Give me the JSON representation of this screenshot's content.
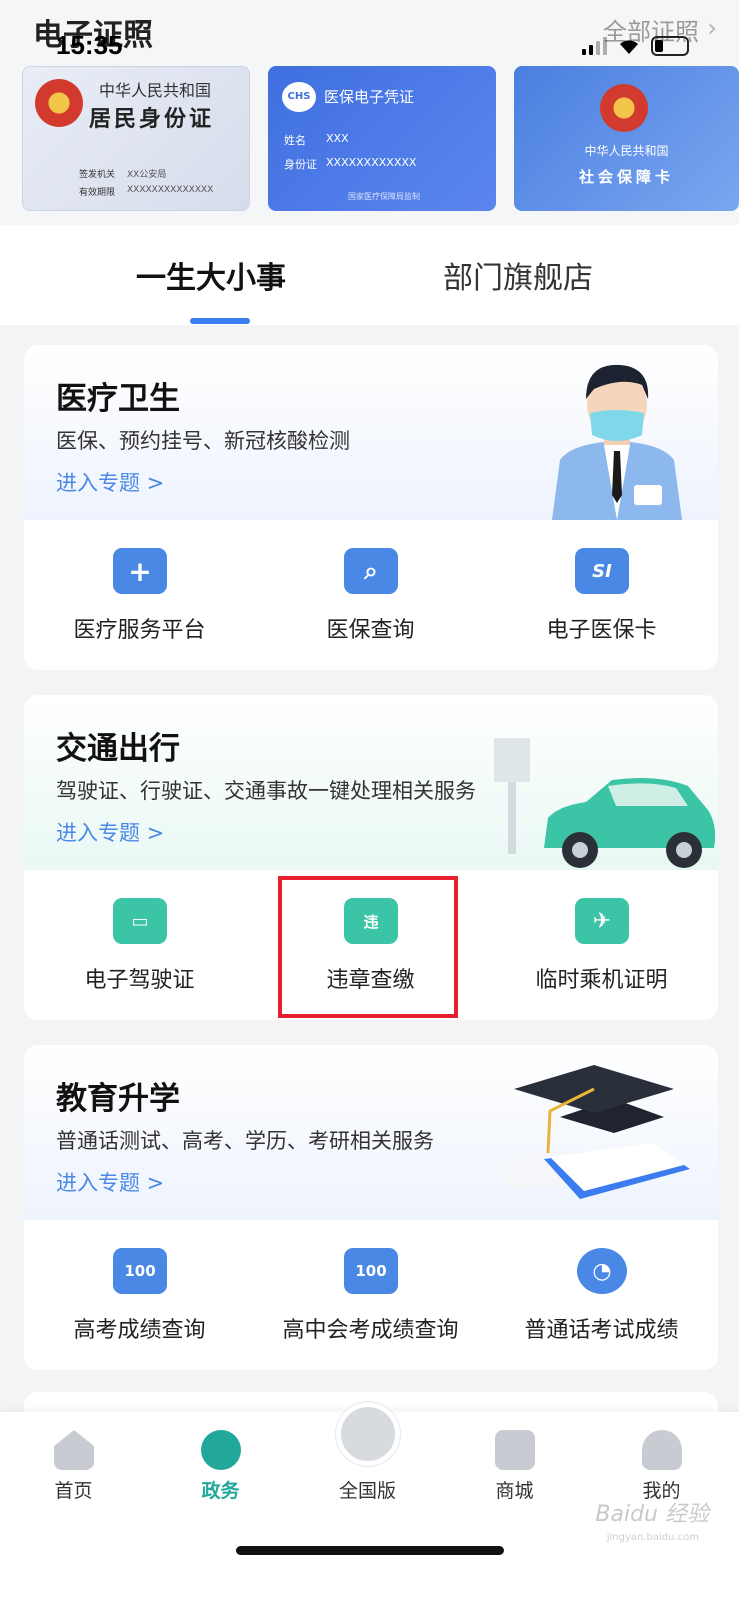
{
  "status": {
    "time": "15:35"
  },
  "certs": {
    "title": "电子证照",
    "all_label": "全部证照",
    "arrow": "›",
    "id_card": {
      "line1": "中华人民共和国",
      "line2": "居民身份证",
      "issuer_label": "签发机关",
      "issuer": "XX公安局",
      "valid_label": "有效期限",
      "valid": "XXXXXXXXXXXXXX"
    },
    "medical": {
      "brand": "CHS",
      "title": "医保电子凭证",
      "name_label": "姓名",
      "name": "XXX",
      "id_label": "身份证",
      "id": "XXXXXXXXXXXX",
      "footer": "国家医疗保障局监制"
    },
    "social": {
      "line1": "中华人民共和国",
      "line2": "社会保障卡"
    }
  },
  "tabs": {
    "active": "一生大小事",
    "other": "部门旗舰店"
  },
  "sections": [
    {
      "title": "医疗卫生",
      "subtitle": "医保、预约挂号、新冠核酸检测",
      "link": "进入专题 >",
      "items": [
        {
          "label": "医疗服务平台",
          "icon": "medical-kit-icon",
          "glyph": "+"
        },
        {
          "label": "医保查询",
          "icon": "medical-search-icon",
          "glyph": "⌕"
        },
        {
          "label": "电子医保卡",
          "icon": "si-card-icon",
          "glyph": "SI"
        }
      ]
    },
    {
      "title": "交通出行",
      "subtitle": "驾驶证、行驶证、交通事故一键处理相关服务",
      "link": "进入专题 >",
      "items": [
        {
          "label": "电子驾驶证",
          "icon": "license-card-icon",
          "glyph": "▭"
        },
        {
          "label": "违章查缴",
          "icon": "car-violation-icon",
          "glyph": "违"
        },
        {
          "label": "临时乘机证明",
          "icon": "boarding-pass-icon",
          "glyph": "✈"
        }
      ]
    },
    {
      "title": "教育升学",
      "subtitle": "普通话测试、高考、学历、考研相关服务",
      "link": "进入专题 >",
      "items": [
        {
          "label": "高考成绩查询",
          "icon": "score-100-search-icon",
          "glyph": "100"
        },
        {
          "label": "高中会考成绩查询",
          "icon": "score-100-icon",
          "glyph": "100"
        },
        {
          "label": "普通话考试成绩",
          "icon": "speech-icon",
          "glyph": "◔"
        }
      ]
    }
  ],
  "tabbar": [
    {
      "label": "首页",
      "color": "#333333"
    },
    {
      "label": "政务",
      "color": "#21a89a"
    },
    {
      "label": "全国版",
      "color": "#333333"
    },
    {
      "label": "商城",
      "color": "#333333"
    },
    {
      "label": "我的",
      "color": "#333333"
    }
  ],
  "watermark": {
    "main": "Baidu 经验",
    "sub": "jingyan.baidu.com"
  },
  "colors": {
    "accent": "#3b7df0",
    "medical": "#4a88e6",
    "traffic": "#3cc4a6",
    "education": "#4a88e6",
    "highlight": "#e6212d",
    "gov": "#21a89a"
  }
}
